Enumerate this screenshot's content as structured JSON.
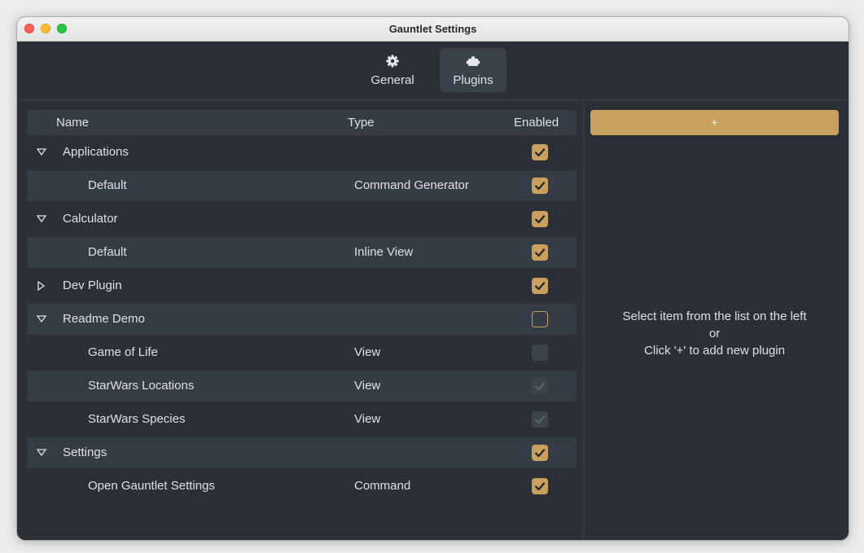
{
  "window": {
    "title": "Gauntlet Settings"
  },
  "toolbar": {
    "general_label": "General",
    "plugins_label": "Plugins",
    "selected": "Plugins"
  },
  "table": {
    "headers": {
      "name": "Name",
      "type": "Type",
      "enabled": "Enabled"
    },
    "rows": [
      {
        "name": "Applications",
        "type": "",
        "enabled": "checked",
        "level": "parent",
        "expanded": true
      },
      {
        "name": "Default",
        "type": "Command Generator",
        "enabled": "checked",
        "level": "child"
      },
      {
        "name": "Calculator",
        "type": "",
        "enabled": "checked",
        "level": "parent",
        "expanded": true
      },
      {
        "name": "Default",
        "type": "Inline View",
        "enabled": "checked",
        "level": "child"
      },
      {
        "name": "Dev Plugin",
        "type": "",
        "enabled": "checked",
        "level": "parent",
        "expanded": false
      },
      {
        "name": "Readme Demo",
        "type": "",
        "enabled": "unchecked",
        "level": "parent",
        "expanded": true
      },
      {
        "name": "Game of Life",
        "type": "View",
        "enabled": "disabled-unchecked",
        "level": "child"
      },
      {
        "name": "StarWars Locations",
        "type": "View",
        "enabled": "disabled-checked",
        "level": "child"
      },
      {
        "name": "StarWars Species",
        "type": "View",
        "enabled": "disabled-checked",
        "level": "child"
      },
      {
        "name": "Settings",
        "type": "",
        "enabled": "checked",
        "level": "parent",
        "expanded": true
      },
      {
        "name": "Open Gauntlet Settings",
        "type": "Command",
        "enabled": "checked",
        "level": "child"
      }
    ]
  },
  "right_panel": {
    "add_label": "+",
    "hint_line1": "Select item from the list on the left",
    "hint_line2": "or",
    "hint_line3": "Click '+' to add new plugin"
  },
  "colors": {
    "accent": "#c9a05d",
    "background": "#2b3037",
    "row_alt": "#363c45",
    "text": "#dde1e6"
  },
  "icons": {
    "general": "gear-icon",
    "plugins": "puzzle-icon",
    "expanded": "triangle-down-icon",
    "collapsed": "triangle-right-icon",
    "checkbox_checked": "checkmark-icon"
  }
}
